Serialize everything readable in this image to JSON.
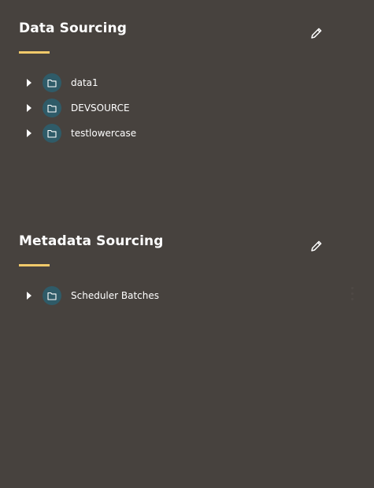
{
  "sections": [
    {
      "title": "Data Sourcing",
      "items": [
        {
          "label": "data1"
        },
        {
          "label": "DEVSOURCE"
        },
        {
          "label": "testlowercase"
        }
      ]
    },
    {
      "title": "Metadata Sourcing",
      "items": [
        {
          "label": "Scheduler Batches"
        }
      ]
    }
  ],
  "icons": {
    "edit": "pencil-icon",
    "expand": "caret-right-icon",
    "folder": "folder-icon"
  },
  "colors": {
    "background": "#47423e",
    "accent_underline": "#f1c96a",
    "folder_badge": "#2f5b68",
    "text": "#ffffff"
  }
}
